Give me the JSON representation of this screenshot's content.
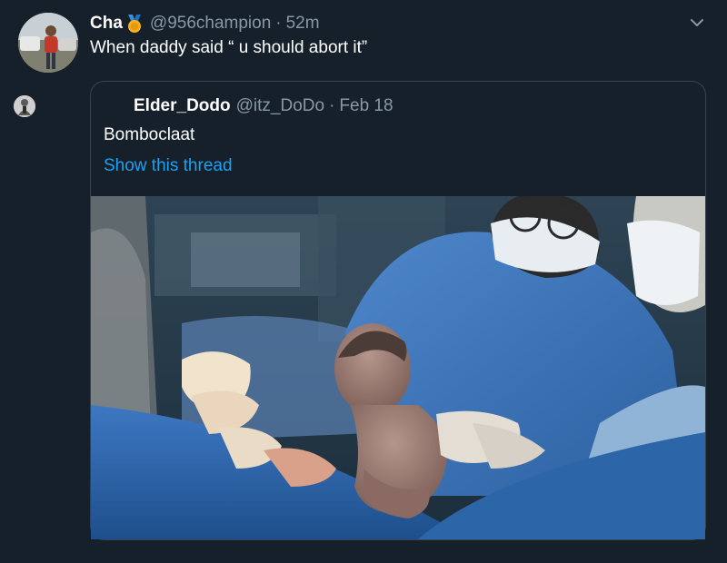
{
  "tweet": {
    "author_name": "Cha",
    "author_handle": "@956champion",
    "separator": "·",
    "time": "52m",
    "text": "When daddy said “ u should abort it”",
    "avatar_icon": "profile-photo",
    "badge_icon": "medal-icon",
    "menu_icon": "chevron-down-icon"
  },
  "quoted_tweet": {
    "author_name": "Elder_Dodo",
    "author_handle": "@itz_DoDo",
    "separator": "·",
    "date": "Feb 18",
    "text": "Bomboclaat",
    "show_thread": "Show this thread",
    "avatar_icon": "profile-photo"
  },
  "colors": {
    "background": "#15202b",
    "muted": "#8899a6",
    "link": "#1da1f2",
    "border": "#38444d"
  }
}
